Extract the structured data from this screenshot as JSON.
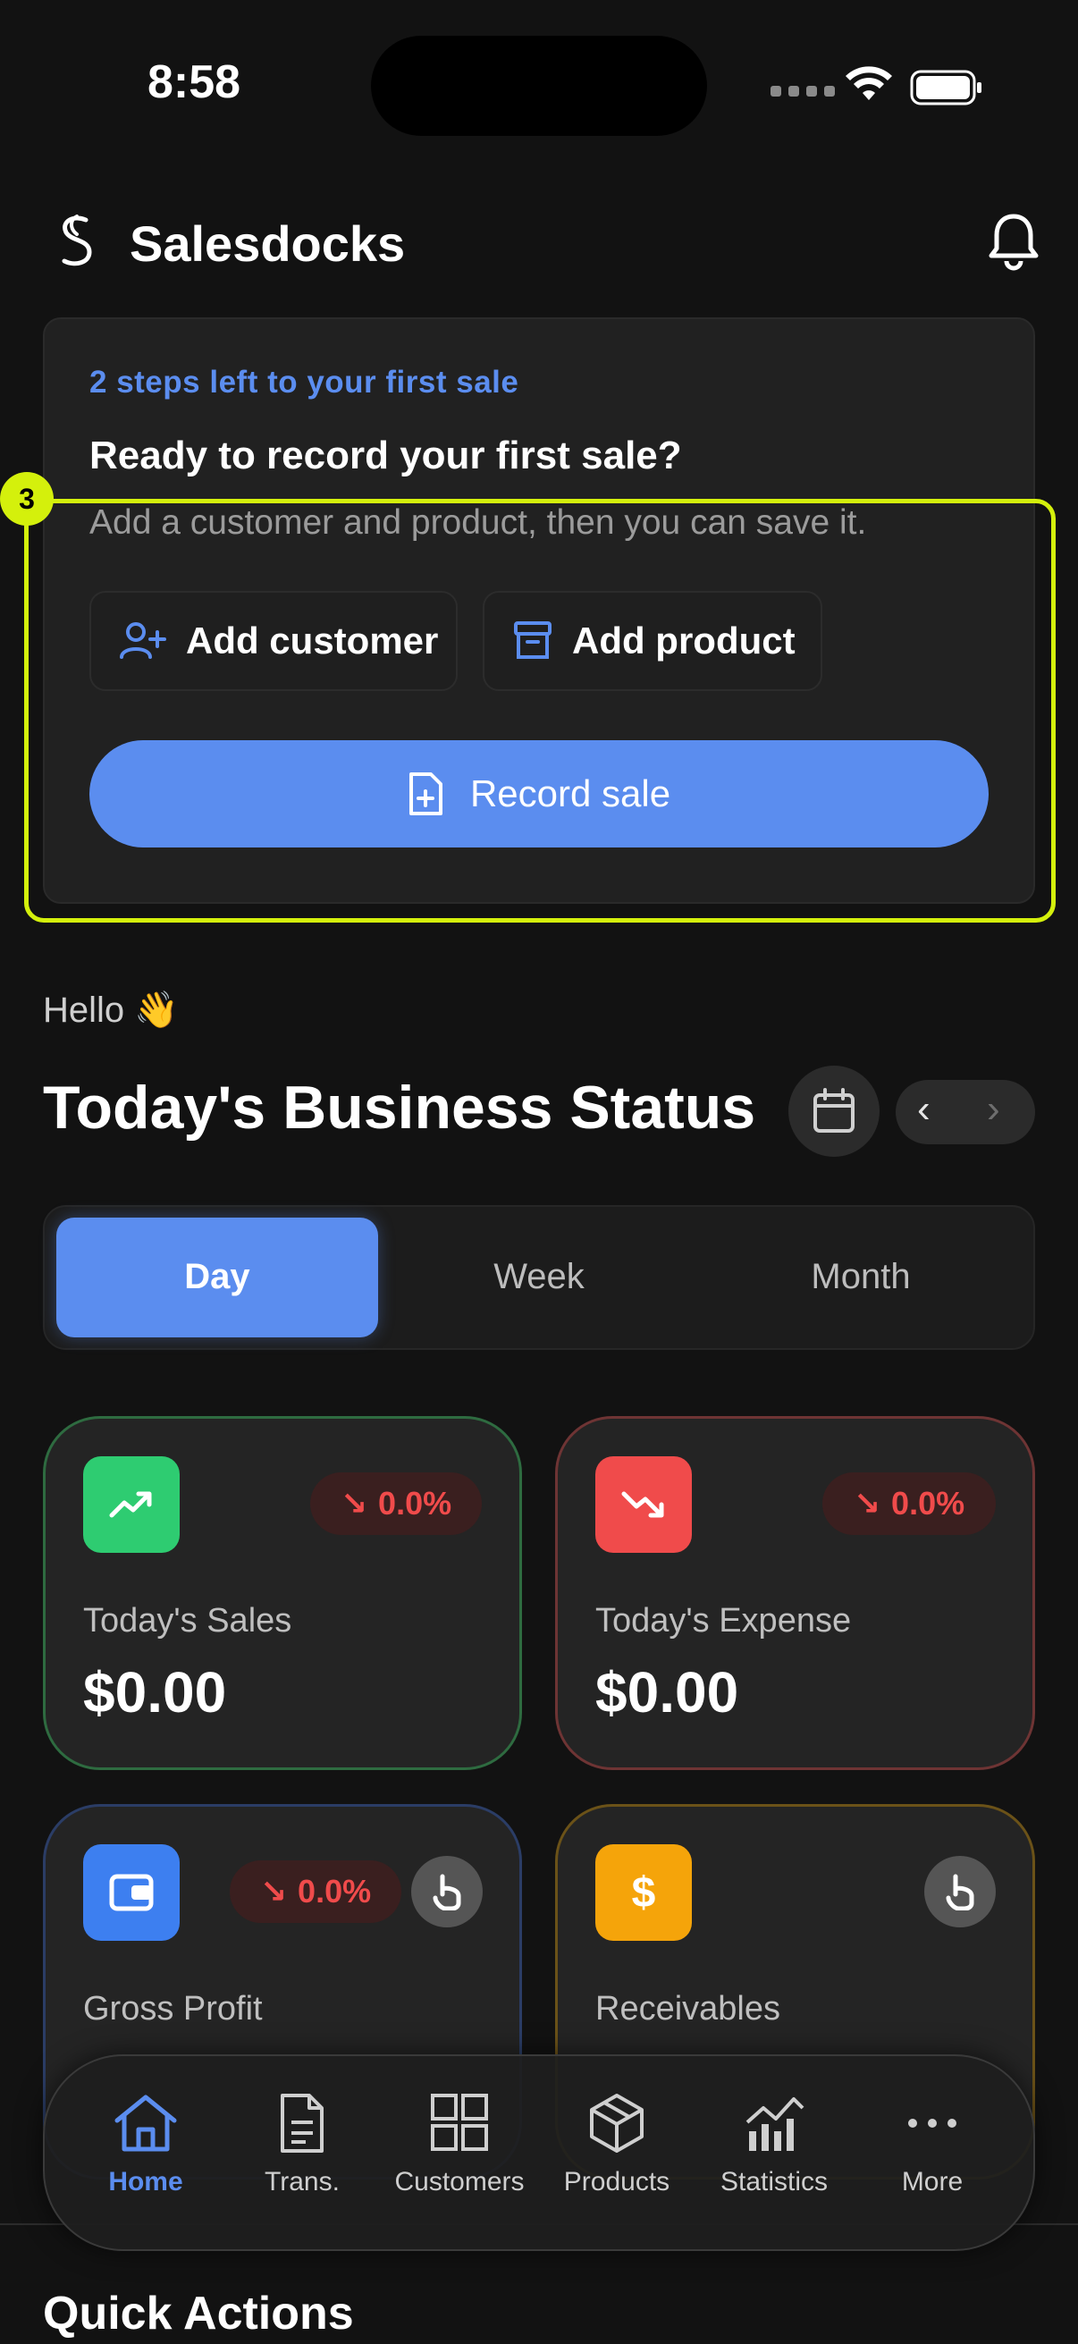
{
  "status_bar": {
    "time": "8:58"
  },
  "header": {
    "app_title": "Salesdocks"
  },
  "onboarding": {
    "steps_left": "2 steps left to your first sale",
    "title": "Ready to record your first sale?",
    "description": "Add a customer and product, then you can save it.",
    "add_customer_label": "Add customer",
    "add_product_label": "Add product",
    "record_sale_label": "Record sale",
    "highlight_badge": "3"
  },
  "greeting": "Hello 👋",
  "section_title": "Today's Business Status",
  "period_tabs": {
    "day": "Day",
    "week": "Week",
    "month": "Month",
    "selected": "Day"
  },
  "metrics": {
    "sales": {
      "label": "Today's Sales",
      "value": "$0.00",
      "trend": "0.0%",
      "color": "#2ecc71"
    },
    "expense": {
      "label": "Today's Expense",
      "value": "$0.00",
      "trend": "0.0%",
      "color": "#f04b4b"
    },
    "profit": {
      "label": "Gross Profit",
      "trend": "0.0%",
      "color": "#3d7ff0"
    },
    "receivables": {
      "label": "Receivables",
      "color": "#f5a40a"
    }
  },
  "bottom_nav": {
    "home": "Home",
    "trans": "Trans.",
    "customers": "Customers",
    "products": "Products",
    "statistics": "Statistics",
    "more": "More",
    "active": "Home"
  },
  "quick_actions_title": "Quick Actions",
  "colors": {
    "accent": "#5b8def",
    "highlight": "#d4f00c",
    "background": "#121212"
  }
}
